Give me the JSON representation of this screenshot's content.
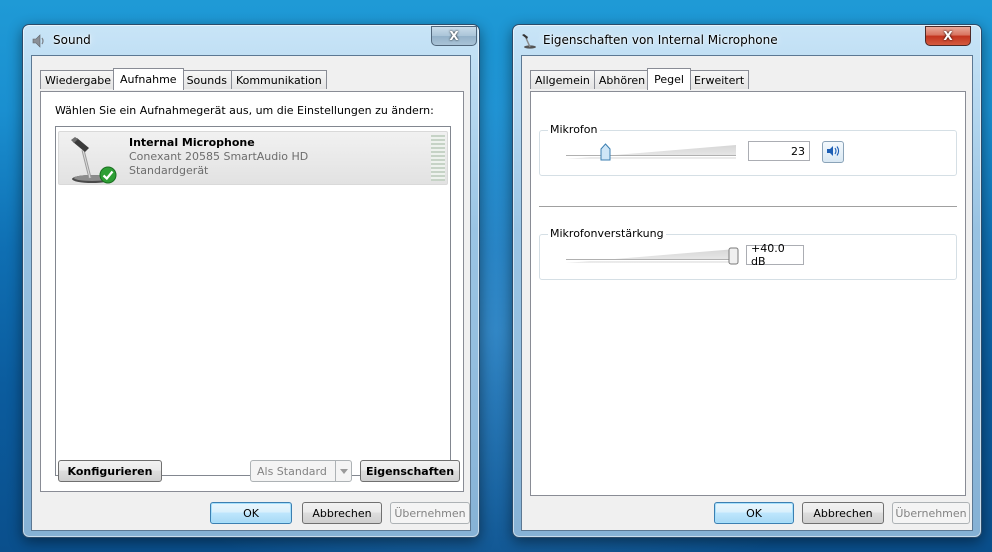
{
  "sound_window": {
    "title": "Sound",
    "close_label": "X",
    "tabs": [
      {
        "label": "Wiedergabe"
      },
      {
        "label": "Aufnahme"
      },
      {
        "label": "Sounds"
      },
      {
        "label": "Kommunikation"
      }
    ],
    "active_tab": "Aufnahme",
    "instruction": "Wählen Sie ein Aufnahmegerät aus, um die Einstellungen zu ändern:",
    "device": {
      "name": "Internal Microphone",
      "driver": "Conexant 20585 SmartAudio HD",
      "status": "Standardgerät",
      "icon": "microphone-icon",
      "default_badge": "checkmark-icon"
    },
    "buttons": {
      "configure": "Konfigurieren",
      "set_default": "Als Standard",
      "properties": "Eigenschaften",
      "ok": "OK",
      "cancel": "Abbrechen",
      "apply": "Übernehmen"
    }
  },
  "props_window": {
    "title": "Eigenschaften von Internal Microphone",
    "close_label": "X",
    "tabs": [
      {
        "label": "Allgemein"
      },
      {
        "label": "Abhören"
      },
      {
        "label": "Pegel"
      },
      {
        "label": "Erweitert"
      }
    ],
    "active_tab": "Pegel",
    "microphone": {
      "label": "Mikrofon",
      "value": "23",
      "level_fraction": 0.23,
      "speaker_icon": "speaker-icon"
    },
    "boost": {
      "label": "Mikrofonverstärkung",
      "value": "+40.0 dB",
      "level_fraction": 1.0
    },
    "buttons": {
      "ok": "OK",
      "cancel": "Abbrechen",
      "apply": "Übernehmen"
    }
  },
  "colors": {
    "desktop": "#0f6fb3",
    "selection": "#e6e6e6",
    "close_active": "#c2331e"
  }
}
